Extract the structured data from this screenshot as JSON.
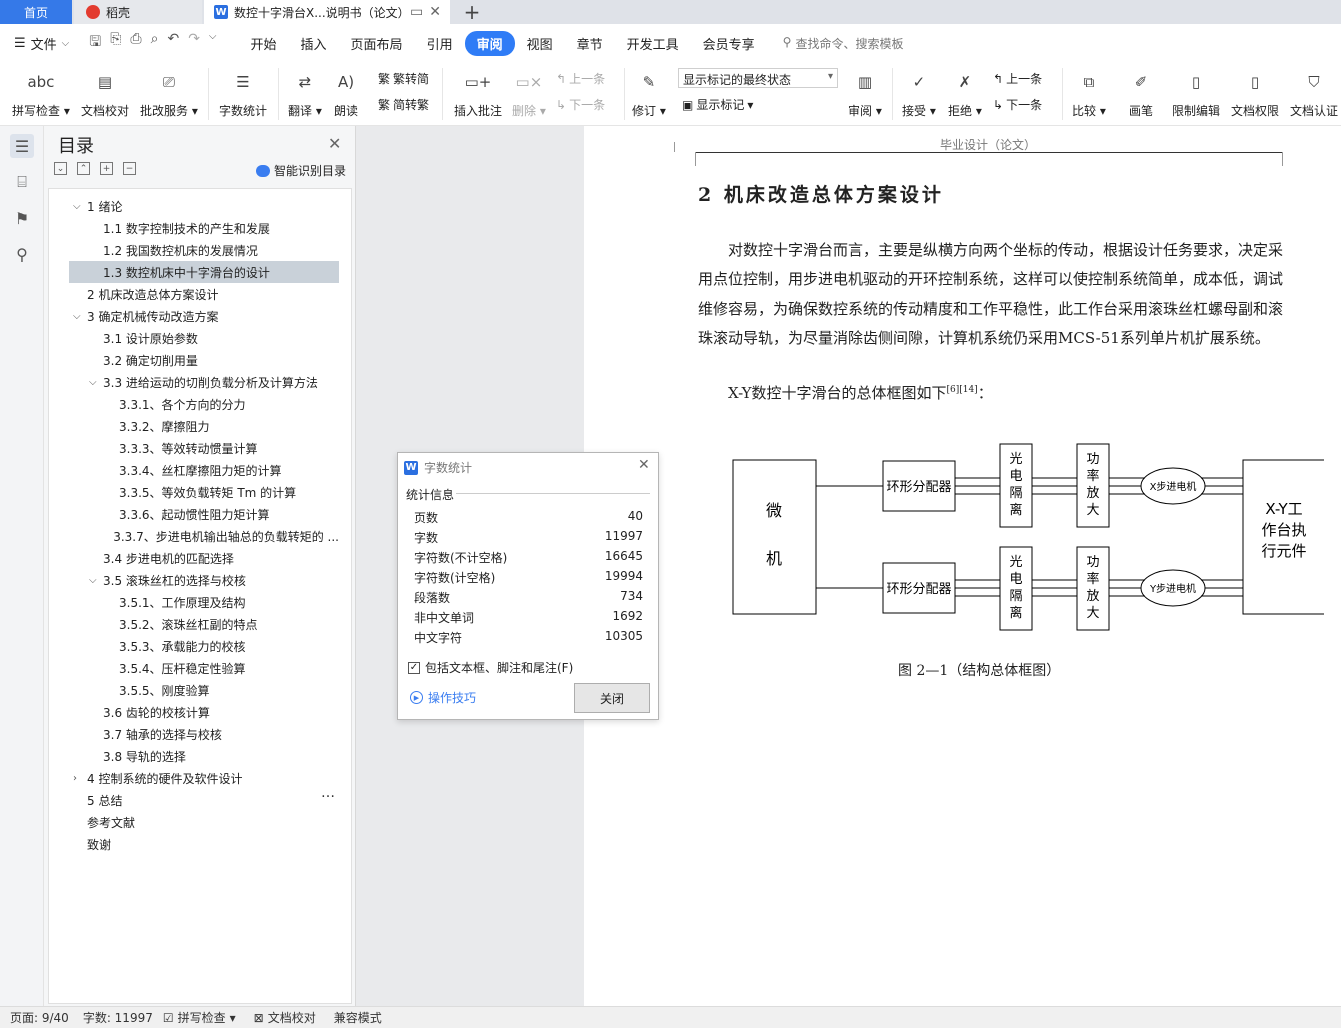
{
  "tabs": {
    "home": "首页",
    "daoke": "稻壳",
    "doc": "数控十字滑台X...说明书（论文）"
  },
  "menu": {
    "file": "文件",
    "tabs": [
      "开始",
      "插入",
      "页面布局",
      "引用",
      "审阅",
      "视图",
      "章节",
      "开发工具",
      "会员专享"
    ],
    "search": "查找命令、搜索模板"
  },
  "ribbon": {
    "spell": "拼写检查",
    "proof": "文档校对",
    "batch": "批改服务",
    "wordcount": "字数统计",
    "translate": "翻译",
    "read": "朗读",
    "trad": "繁转简",
    "simp": "简转繁",
    "insert_comment": "插入批注",
    "delete": "删除",
    "prev_comment": "上一条",
    "next_comment": "下一条",
    "revise": "修订",
    "markup_select": "显示标记的最终状态",
    "show_markup": "显示标记",
    "review": "审阅",
    "accept": "接受",
    "reject": "拒绝",
    "prev": "上一条",
    "next": "下一条",
    "compare": "比较",
    "pen": "画笔",
    "restrict": "限制编辑",
    "rights": "文档权限",
    "auth": "文档认证"
  },
  "toc": {
    "title": "目录",
    "smart": "智能识别目录",
    "items": [
      {
        "text": "1  绪论",
        "level": 0,
        "arrow": "v"
      },
      {
        "text": "1.1 数字控制技术的产生和发展",
        "level": 1,
        "arrow": ""
      },
      {
        "text": "1.2 我国数控机床的发展情况",
        "level": 1,
        "arrow": ""
      },
      {
        "text": "1.3 数控机床中十字滑台的设计",
        "level": 1,
        "arrow": "",
        "selected": true
      },
      {
        "text": "2  机床改造总体方案设计",
        "level": 0,
        "arrow": ""
      },
      {
        "text": "3  确定机械传动改造方案",
        "level": 0,
        "arrow": "v"
      },
      {
        "text": "3.1  设计原始参数",
        "level": 1,
        "arrow": ""
      },
      {
        "text": "3.2  确定切削用量",
        "level": 1,
        "arrow": ""
      },
      {
        "text": "3.3  进给运动的切削负载分析及计算方法",
        "level": 1,
        "arrow": "v"
      },
      {
        "text": "3.3.1、各个方向的分力",
        "level": 2,
        "arrow": ""
      },
      {
        "text": "3.3.2、摩擦阻力",
        "level": 2,
        "arrow": ""
      },
      {
        "text": "3.3.3、等效转动惯量计算",
        "level": 2,
        "arrow": ""
      },
      {
        "text": "3.3.4、丝杠摩擦阻力矩的计算",
        "level": 2,
        "arrow": ""
      },
      {
        "text": "3.3.5、等效负载转矩 Tm 的计算",
        "level": 2,
        "arrow": ""
      },
      {
        "text": "3.3.6、起动惯性阻力矩计算",
        "level": 2,
        "arrow": ""
      },
      {
        "text": "3.3.7、步进电机输出轴总的负载转矩的 ...",
        "level": 2,
        "arrow": ""
      },
      {
        "text": "3.4  步进电机的匹配选择",
        "level": 1,
        "arrow": ""
      },
      {
        "text": "3.5  滚珠丝杠的选择与校核",
        "level": 1,
        "arrow": "v"
      },
      {
        "text": "3.5.1、工作原理及结构",
        "level": 2,
        "arrow": ""
      },
      {
        "text": "3.5.2、滚珠丝杠副的特点",
        "level": 2,
        "arrow": ""
      },
      {
        "text": "3.5.3、承载能力的校核",
        "level": 2,
        "arrow": ""
      },
      {
        "text": "3.5.4、压杆稳定性验算",
        "level": 2,
        "arrow": ""
      },
      {
        "text": "3.5.5、刚度验算",
        "level": 2,
        "arrow": ""
      },
      {
        "text": "3.6  齿轮的校核计算",
        "level": 1,
        "arrow": ""
      },
      {
        "text": "3.7  轴承的选择与校核",
        "level": 1,
        "arrow": ""
      },
      {
        "text": "3.8  导轨的选择",
        "level": 1,
        "arrow": ""
      },
      {
        "text": "4  控制系统的硬件及软件设计",
        "level": 0,
        "arrow": ">"
      },
      {
        "text": "5  总结",
        "level": 0,
        "arrow": ""
      },
      {
        "text": "参考文献",
        "level": 0,
        "arrow": ""
      },
      {
        "text": "致谢",
        "level": 0,
        "arrow": ""
      }
    ]
  },
  "doc": {
    "header": "毕业设计（论文）",
    "heading": "2  机床改造总体方案设计",
    "para1": "对数控十字滑台而言，主要是纵横方向两个坐标的传动，根据设计任务要求，决定采用点位控制，用步进电机驱动的开环控制系统，这样可以使控制系统简单，成本低，调试维修容易，为确保数控系统的传动精度和工作平稳性，此工作台采用滚珠丝杠螺母副和滚珠滚动导轨，为尽量消除齿侧间隙，计算机系统仍采用MCS-51系列单片机扩展系统。",
    "para2": "X-Y数控十字滑台的总体框图如下",
    "para2_ref": "[6][14]",
    "para2_end": "：",
    "diagram": {
      "micro1": "微",
      "micro2": "机",
      "dist1": "环形分配器",
      "dist2": "环形分配器",
      "iso1": [
        "光",
        "电",
        "隔",
        "离"
      ],
      "iso2": [
        "光",
        "电",
        "隔",
        "离"
      ],
      "amp1": [
        "功",
        "率",
        "放",
        "大"
      ],
      "amp2": [
        "功",
        "率",
        "放",
        "大"
      ],
      "motor_x": "X步进电机",
      "motor_y": "Y步进电机",
      "exec": [
        "X-Y工",
        "作台执",
        "行元件"
      ]
    },
    "caption": "图 2—1（结构总体框图）"
  },
  "dialog": {
    "title": "字数统计",
    "section": "统计信息",
    "rows": [
      {
        "label": "页数",
        "value": "40"
      },
      {
        "label": "字数",
        "value": "11997"
      },
      {
        "label": "字符数(不计空格)",
        "value": "16645"
      },
      {
        "label": "字符数(计空格)",
        "value": "19994"
      },
      {
        "label": "段落数",
        "value": "734"
      },
      {
        "label": "非中文单词",
        "value": "1692"
      },
      {
        "label": "中文字符",
        "value": "10305"
      }
    ],
    "checkbox": "包括文本框、脚注和尾注(F)",
    "tips": "操作技巧",
    "close": "关闭"
  },
  "status": {
    "page": "页面: 9/40",
    "words": "字数: 11997",
    "spell": "拼写检查",
    "proof": "文档校对",
    "compat": "兼容模式"
  },
  "colors": {
    "accent": "#2f7cf6",
    "home_tab": "#3579e8",
    "selected_toc": "#c9d1d9"
  }
}
